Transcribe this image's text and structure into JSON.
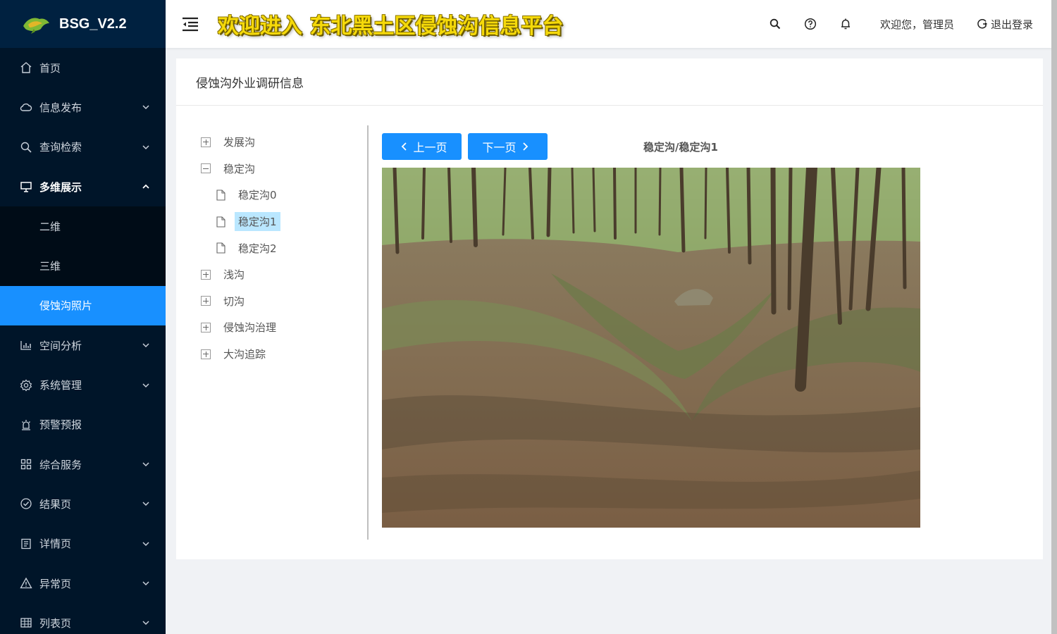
{
  "app": {
    "title": "BSG_V2.2"
  },
  "sidebar": {
    "items": [
      {
        "label": "首页",
        "icon": "home-icon"
      },
      {
        "label": "信息发布",
        "icon": "cloud-icon"
      },
      {
        "label": "查询检索",
        "icon": "search-icon"
      },
      {
        "label": "多维展示",
        "icon": "monitor-icon",
        "open": true,
        "children": [
          {
            "label": "二维"
          },
          {
            "label": "三维"
          },
          {
            "label": "侵蚀沟照片",
            "selected": true
          }
        ]
      },
      {
        "label": "空间分析",
        "icon": "bar-chart-icon"
      },
      {
        "label": "系统管理",
        "icon": "gear-icon"
      },
      {
        "label": "预警预报",
        "icon": "alarm-icon"
      },
      {
        "label": "综合服务",
        "icon": "grid-icon"
      },
      {
        "label": "结果页",
        "icon": "check-circle-icon"
      },
      {
        "label": "详情页",
        "icon": "profile-icon"
      },
      {
        "label": "异常页",
        "icon": "warning-icon"
      },
      {
        "label": "列表页",
        "icon": "table-icon"
      }
    ]
  },
  "header": {
    "banner": "欢迎进入 东北黑土区侵蚀沟信息平台",
    "welcome": "欢迎您，管理员",
    "logout": "退出登录",
    "icons": [
      "search-icon",
      "question-circle-icon",
      "bell-icon"
    ]
  },
  "card": {
    "title": "侵蚀沟外业调研信息",
    "tree": [
      {
        "label": "发展沟",
        "expanded": false
      },
      {
        "label": "稳定沟",
        "expanded": true,
        "children": [
          {
            "label": "稳定沟0"
          },
          {
            "label": "稳定沟1",
            "selected": true
          },
          {
            "label": "稳定沟2"
          }
        ]
      },
      {
        "label": "浅沟",
        "expanded": false
      },
      {
        "label": "切沟",
        "expanded": false
      },
      {
        "label": "侵蚀沟治理",
        "expanded": false
      },
      {
        "label": "大沟追踪",
        "expanded": false
      }
    ],
    "prev_label": "上一页",
    "next_label": "下一页",
    "current_path": "稳定沟/稳定沟1"
  },
  "colors": {
    "sidebar_bg": "#001529",
    "accent": "#1890ff",
    "banner_yellow": "#f5d90a",
    "tree_selected": "#bae7ff"
  }
}
